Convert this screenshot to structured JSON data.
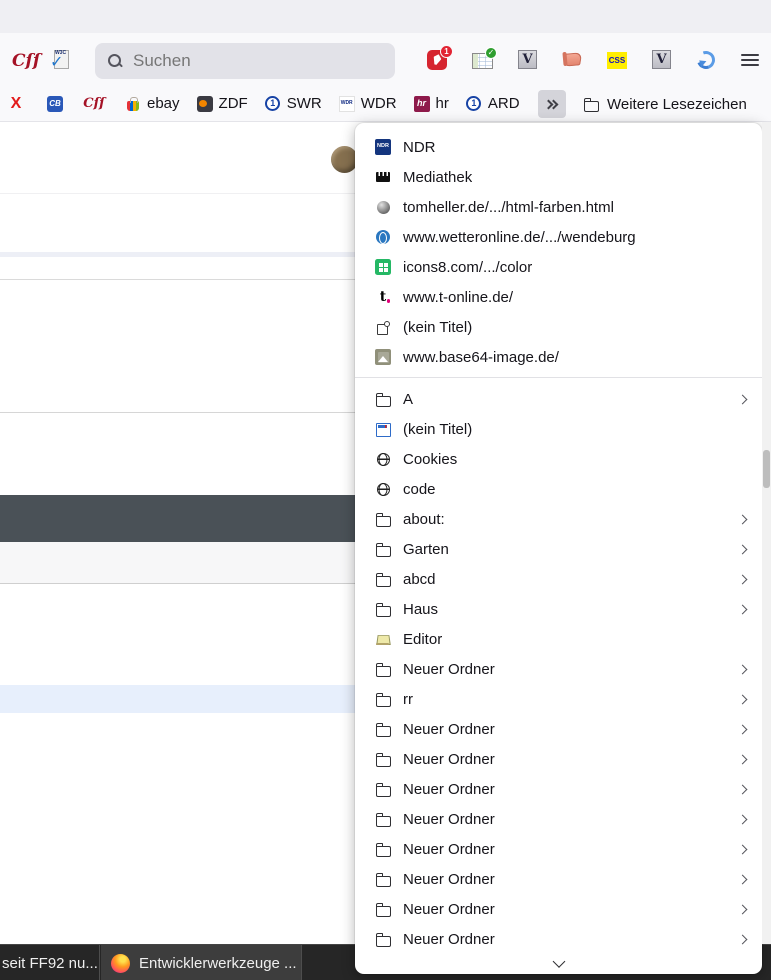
{
  "toolbar": {
    "search_placeholder": "Suchen",
    "icon_texts": {
      "css_cursive": "Cſſ",
      "w3c": "W3C",
      "w3c_check": "✓",
      "badge_count": "1",
      "table_check": "✓",
      "v_letter": "V",
      "css_yellow": "CSS"
    },
    "right_icons": [
      "downloads-pin-badge-icon",
      "table-check-icon",
      "validator-v-icon",
      "script-scroll-icon",
      "css-yellow-icon",
      "validator-v-icon",
      "sync-icon",
      "menu-icon"
    ]
  },
  "bookmarks_bar": {
    "items": [
      {
        "label": "",
        "icon": "x",
        "icon_text": "X"
      },
      {
        "label": "",
        "icon": "cb",
        "icon_text": "CB"
      },
      {
        "label": "",
        "icon": "css",
        "icon_text": "Cſſ"
      },
      {
        "label": "ebay",
        "icon": "ebay",
        "icon_text": ""
      },
      {
        "label": "ZDF",
        "icon": "zdf",
        "icon_text": ""
      },
      {
        "label": "SWR",
        "icon": "ard",
        "icon_text": "1"
      },
      {
        "label": "WDR",
        "icon": "wdr",
        "icon_text": "WDR"
      },
      {
        "label": "hr",
        "icon": "hr",
        "icon_text": "hr"
      },
      {
        "label": "ARD",
        "icon": "ard",
        "icon_text": "1"
      }
    ],
    "more_bookmarks_label": "Weitere Lesezeichen"
  },
  "overflow_menu": {
    "links": [
      {
        "label": "NDR",
        "icon": "ndr",
        "icon_text": "NDR"
      },
      {
        "label": "Mediathek",
        "icon": "clapper",
        "icon_text": ""
      },
      {
        "label": "tomheller.de/.../html-farben.html",
        "icon": "sphere",
        "icon_text": ""
      },
      {
        "label": "www.wetteronline.de/.../wendeburg",
        "icon": "wetter",
        "icon_text": ""
      },
      {
        "label": "icons8.com/.../color",
        "icon": "icons8",
        "icon_text": ""
      },
      {
        "label": "www.t-online.de/",
        "icon": "tonline",
        "icon_text": "t"
      },
      {
        "label": "(kein Titel)",
        "icon": "puzzle",
        "icon_text": ""
      },
      {
        "label": "www.base64-image.de/",
        "icon": "image",
        "icon_text": ""
      }
    ],
    "folders": [
      {
        "label": "A",
        "icon": "folder",
        "submenu": true
      },
      {
        "label": "(kein Titel)",
        "icon": "window",
        "submenu": false
      },
      {
        "label": "Cookies",
        "icon": "globe",
        "submenu": false
      },
      {
        "label": "code",
        "icon": "globe",
        "submenu": false
      },
      {
        "label": "about:",
        "icon": "folder",
        "submenu": true
      },
      {
        "label": "Garten",
        "icon": "folder",
        "submenu": true
      },
      {
        "label": "abcd",
        "icon": "folder",
        "submenu": true
      },
      {
        "label": "Haus",
        "icon": "folder",
        "submenu": true
      },
      {
        "label": "Editor",
        "icon": "notepad",
        "submenu": false
      },
      {
        "label": "Neuer Ordner",
        "icon": "folder",
        "submenu": true
      },
      {
        "label": "rr",
        "icon": "folder",
        "submenu": true
      },
      {
        "label": "Neuer Ordner",
        "icon": "folder",
        "submenu": true
      },
      {
        "label": "Neuer Ordner",
        "icon": "folder",
        "submenu": true
      },
      {
        "label": "Neuer Ordner",
        "icon": "folder",
        "submenu": true
      },
      {
        "label": "Neuer Ordner",
        "icon": "folder",
        "submenu": true
      },
      {
        "label": "Neuer Ordner",
        "icon": "folder",
        "submenu": true
      },
      {
        "label": "Neuer Ordner",
        "icon": "folder",
        "submenu": true
      },
      {
        "label": "Neuer Ordner",
        "icon": "folder",
        "submenu": true
      },
      {
        "label": "Neuer Ordner",
        "icon": "folder",
        "submenu": true
      }
    ]
  },
  "taskbar": {
    "window1_label": "seit FF92 nu...",
    "window2_label": "Entwicklerwerkzeuge ..."
  },
  "colors": {
    "toolbar_bg": "#f9f9fb",
    "titlebar_bg": "#efeff3",
    "dark_row": "#4a5157",
    "highlight_row": "#e7effc",
    "taskbar_bg": "#262626",
    "active_task_bg": "#3d3d3d",
    "menu_text": "#15141a"
  }
}
